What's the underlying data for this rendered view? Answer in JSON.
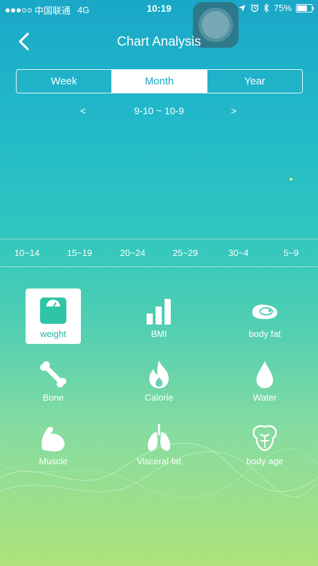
{
  "status_bar": {
    "carrier": "中国联通",
    "network": "4G",
    "time": "10:19",
    "battery": "75%",
    "battery_level": 0.75,
    "signal_bars_filled": 3,
    "signal_bars_total": 5
  },
  "nav": {
    "title": "Chart Analysis"
  },
  "tabs": [
    {
      "label": "Week",
      "active": false
    },
    {
      "label": "Month",
      "active": true
    },
    {
      "label": "Year",
      "active": false
    }
  ],
  "period": {
    "prev": "<",
    "range": "9-10 ~ 10-9",
    "next": ">"
  },
  "x_ticks": [
    "10~14",
    "15~19",
    "20~24",
    "25~29",
    "30~4",
    "5~9"
  ],
  "metrics": [
    {
      "label": "weight",
      "icon": "scale-icon",
      "selected": true
    },
    {
      "label": "BMI",
      "icon": "bar-chart-icon",
      "selected": false
    },
    {
      "label": "body fat",
      "icon": "meat-icon",
      "selected": false
    },
    {
      "label": "Bone",
      "icon": "bone-icon",
      "selected": false
    },
    {
      "label": "Calorie",
      "icon": "flame-icon",
      "selected": false
    },
    {
      "label": "Water",
      "icon": "water-drop-icon",
      "selected": false
    },
    {
      "label": "Muscle",
      "icon": "muscle-arm-icon",
      "selected": false
    },
    {
      "label": "Visceral fat",
      "icon": "lungs-icon",
      "selected": false
    },
    {
      "label": "body age",
      "icon": "torso-icon",
      "selected": false
    }
  ],
  "colors": {
    "accent": "#1aa6c6",
    "selected_icon": "#2ec4a6",
    "data_point": "#eaf27a"
  }
}
